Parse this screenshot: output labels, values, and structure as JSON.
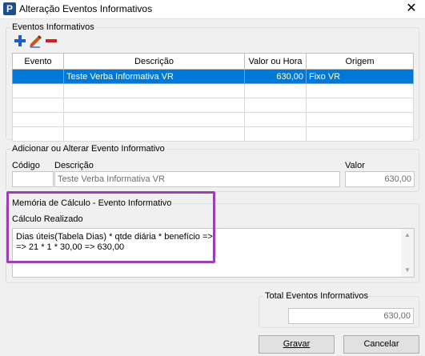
{
  "window": {
    "title": "Alteração Eventos Informativos",
    "close": "✕",
    "app_icon_letter": "P"
  },
  "eventos": {
    "legend": "Eventos Informativos",
    "toolbar": {
      "add": "plus-icon",
      "edit": "pencil-icon",
      "remove": "minus-icon"
    },
    "columns": [
      "Evento",
      "Descrição",
      "Valor ou Hora",
      "Origem"
    ],
    "rows": [
      {
        "evento": "",
        "descricao": "Teste Verba Informativa VR",
        "valor": "630,00",
        "origem": "Fixo VR",
        "selected": true
      }
    ]
  },
  "adicionar": {
    "legend": "Adicionar ou Alterar Evento Informativo",
    "codigo_label": "Código",
    "codigo_value": "",
    "descricao_label": "Descrição",
    "descricao_value": "Teste Verba Informativa VR",
    "valor_label": "Valor",
    "valor_value": "630,00"
  },
  "memoria": {
    "legend": "Memória de Cálculo - Evento Informativo",
    "calculo_label": "Cálculo Realizado",
    "lines": [
      "Dias úteis(Tabela Dias) * qtde diária * benefício =>",
      "=> 21 * 1 * 30,00 => 630,00"
    ]
  },
  "total": {
    "legend": "Total Eventos Informativos",
    "value": "630,00"
  },
  "buttons": {
    "gravar": "Gravar",
    "cancelar": "Cancelar"
  },
  "colors": {
    "selection": "#0078d7",
    "highlight": "#9b3fb5",
    "add": "#1d5fbf",
    "remove": "#d21f1f"
  }
}
